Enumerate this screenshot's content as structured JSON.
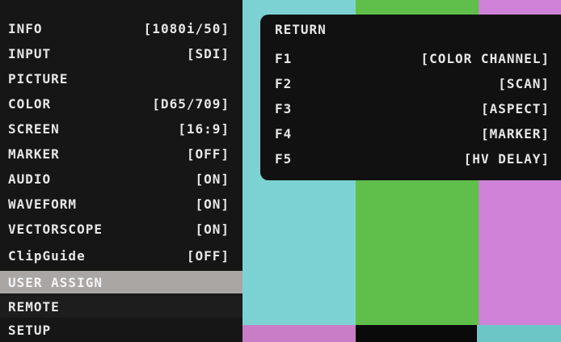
{
  "main_menu": {
    "items": [
      {
        "label": "INFO",
        "value": "[1080i/50]"
      },
      {
        "label": "INPUT",
        "value": "[SDI]"
      },
      {
        "label": "PICTURE",
        "value": ""
      },
      {
        "label": "COLOR",
        "value": "[D65/709]"
      },
      {
        "label": "SCREEN",
        "value": "[16:9]"
      },
      {
        "label": "MARKER",
        "value": "[OFF]"
      },
      {
        "label": "AUDIO",
        "value": "[ON]"
      },
      {
        "label": "WAVEFORM",
        "value": "[ON]"
      },
      {
        "label": "VECTORSCOPE",
        "value": "[ON]"
      },
      {
        "label": "ClipGuide",
        "value": "[OFF]"
      },
      {
        "label": "USER ASSIGN",
        "value": ""
      },
      {
        "label": "REMOTE",
        "value": ""
      },
      {
        "label": "SETUP",
        "value": ""
      }
    ],
    "selected_item": "USER ASSIGN"
  },
  "user_assign_menu": {
    "items": [
      {
        "key": "RETURN",
        "value": ""
      },
      {
        "key": "F1",
        "value": "[COLOR CHANNEL]"
      },
      {
        "key": "F2",
        "value": "[SCAN]"
      },
      {
        "key": "F3",
        "value": "[ASPECT]"
      },
      {
        "key": "F4",
        "value": "[MARKER]"
      },
      {
        "key": "F5",
        "value": "[HV DELAY]"
      }
    ]
  },
  "colors": {
    "menu_background": "#161616",
    "selected_highlight": "#a9a6a3",
    "text": "#e6e6e6",
    "bar_cyan": "#7cd2d2",
    "bar_green": "#5fbf4a",
    "bar_magenta": "#cf82d8"
  }
}
